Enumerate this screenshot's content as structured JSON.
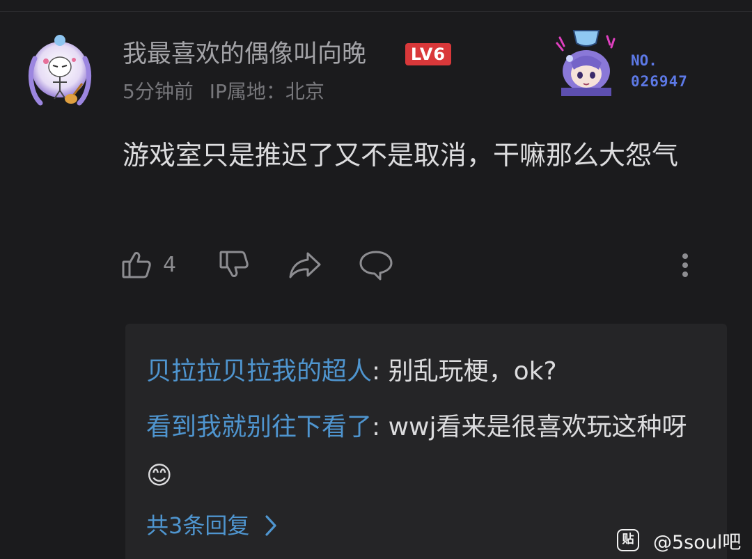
{
  "comment": {
    "author": "我最喜欢的偶像叫向晚",
    "level_badge": "LV6",
    "time": "5分钟前",
    "ip_location": "IP属地：北京",
    "content": "游戏室只是推迟了又不是取消，干嘛那么大怨气",
    "badge_no_label": "NO.",
    "badge_no_number": "026947",
    "likes": "4"
  },
  "actions": {
    "icons": [
      "thumbs-up-icon",
      "thumbs-down-icon",
      "share-icon",
      "comment-icon",
      "more-icon"
    ]
  },
  "replies": [
    {
      "name": "贝拉拉贝拉我的超人",
      "text": ": 别乱玩梗，ok?"
    },
    {
      "name": "看到我就别往下看了",
      "text": ": wwj看来是很喜欢玩这种呀😊"
    }
  ],
  "more_replies_label": "共3条回复",
  "watermark": {
    "logo_text": "贴",
    "text": "@5soul吧"
  },
  "colors": {
    "background": "#1b1b1d",
    "reply_box": "#252527",
    "link_blue": "#4f95cf",
    "level_red": "#d9383a",
    "badge_blue": "#5d79e6"
  }
}
